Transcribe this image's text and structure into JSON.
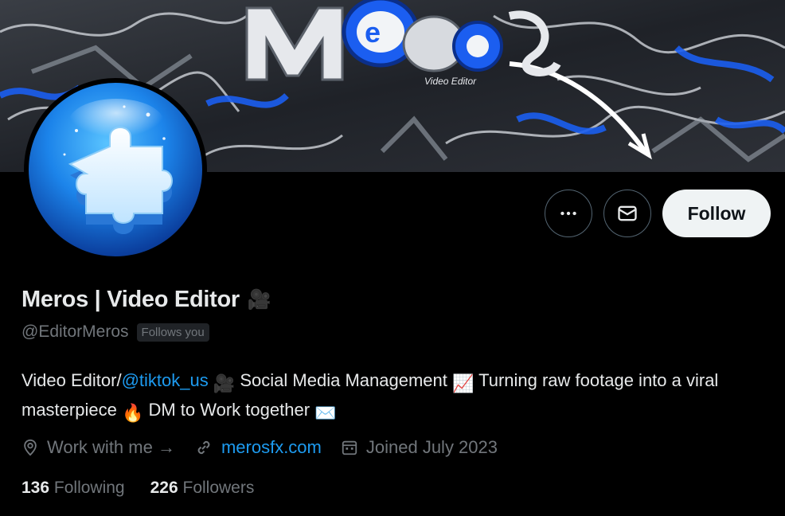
{
  "banner": {
    "title_text": "Meros",
    "subtitle_text": "Video Editor",
    "palette": {
      "base": "#2a2d33",
      "accent": "#1b5ef0",
      "light": "#e6e8ec"
    }
  },
  "avatar": {
    "icon": "puzzle-piece-icon",
    "colors": [
      "#59c3ff",
      "#1c84ea",
      "#0b3f9e"
    ]
  },
  "actions": {
    "more_icon": "more-horizontal-icon",
    "message_icon": "mail-icon",
    "follow_label": "Follow"
  },
  "profile": {
    "display_name": "Meros | Video Editor",
    "name_emoji": "🎥",
    "handle": "@EditorMeros",
    "follows_you": "Follows you"
  },
  "bio": {
    "part1": "Video Editor/",
    "mention": "@tiktok_us",
    "emoji1": "🎥",
    "part2": " Social Media Management ",
    "emoji2": "📈",
    "part3": " Turning raw footage into a viral masterpiece ",
    "emoji3": "🔥",
    "part4": " DM to Work together ",
    "emoji4": "✉️"
  },
  "meta": {
    "location_icon": "location-pin-icon",
    "location": "Work with me →",
    "link_icon": "link-icon",
    "link": "merosfx.com",
    "joined_icon": "calendar-icon",
    "joined": "Joined July 2023"
  },
  "stats": {
    "following_count": "136",
    "following_label": "Following",
    "followers_count": "226",
    "followers_label": "Followers"
  },
  "colors": {
    "link": "#1d9bf0",
    "muted": "#71767b",
    "text": "#e7e9ea"
  }
}
